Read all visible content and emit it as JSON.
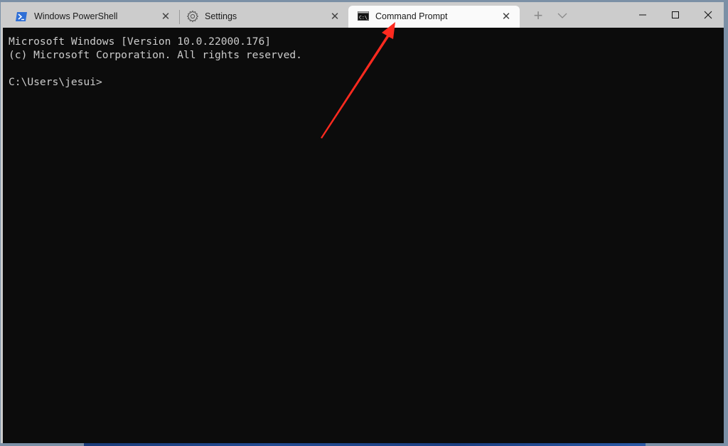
{
  "window": {
    "tabs": [
      {
        "label": "Windows PowerShell",
        "icon": "powershell-icon",
        "active": false
      },
      {
        "label": "Settings",
        "icon": "gear-icon",
        "active": false
      },
      {
        "label": "Command Prompt",
        "icon": "cmd-icon",
        "active": true
      }
    ],
    "new_tab_label": "+",
    "controls": {
      "minimize": "minimize-icon",
      "maximize": "maximize-icon",
      "close": "close-icon"
    }
  },
  "terminal": {
    "lines": [
      "Microsoft Windows [Version 10.0.22000.176]",
      "(c) Microsoft Corporation. All rights reserved.",
      "",
      "C:\\Users\\jesui>"
    ]
  },
  "annotation": {
    "type": "arrow",
    "color": "#ff2a1f",
    "points_to": "Command Prompt tab"
  }
}
